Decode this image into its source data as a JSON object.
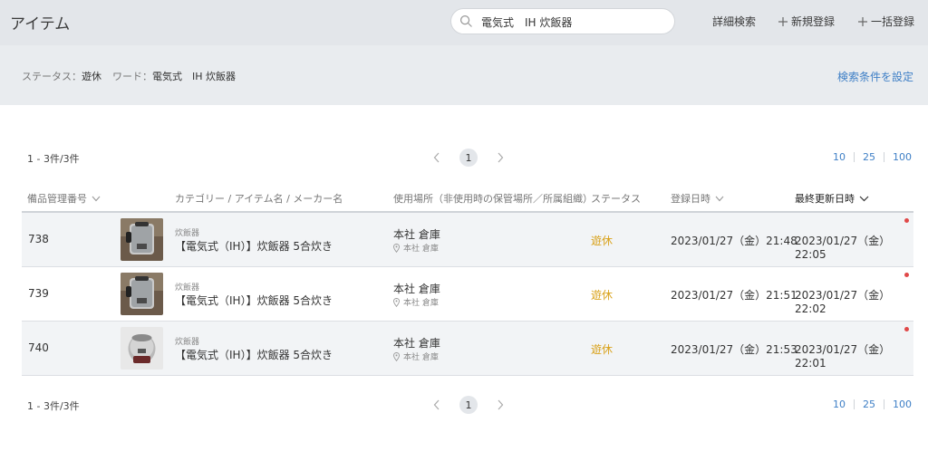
{
  "header": {
    "title": "アイテム",
    "search_value": "電気式　IH 炊飯器",
    "advanced_search": "詳細検索",
    "new_register": "新規登録",
    "bulk_register": "一括登録"
  },
  "filter": {
    "status_label": "ステータス：",
    "status_value": "遊休",
    "word_label": "ワード：",
    "word_value": "電気式　IH 炊飯器",
    "set_conditions": "検索条件を設定"
  },
  "pagination": {
    "count_text": "1 - 3件/3件",
    "current_page": "1",
    "per_page_options": [
      "10",
      "25",
      "100"
    ]
  },
  "table": {
    "columns": {
      "id": "備品管理番号",
      "name": "カテゴリー / アイテム名 / メーカー名",
      "location": "使用場所（非使用時の保管場所／所属組織）",
      "status": "ステータス",
      "registered": "登録日時",
      "updated": "最終更新日時"
    },
    "rows": [
      {
        "id": "738",
        "category": "炊飯器",
        "name": "【電気式（IH）】炊飯器 5合炊き",
        "location": "本社 倉庫",
        "location_sub": "本社 倉庫",
        "status": "遊休",
        "registered": "2023/01/27（金）21:48",
        "updated": "2023/01/27（金）22:05"
      },
      {
        "id": "739",
        "category": "炊飯器",
        "name": "【電気式（IH）】炊飯器 5合炊き",
        "location": "本社 倉庫",
        "location_sub": "本社 倉庫",
        "status": "遊休",
        "registered": "2023/01/27（金）21:51",
        "updated": "2023/01/27（金）22:02"
      },
      {
        "id": "740",
        "category": "炊飯器",
        "name": "【電気式（IH）】炊飯器 5合炊き",
        "location": "本社 倉庫",
        "location_sub": "本社 倉庫",
        "status": "遊休",
        "registered": "2023/01/27（金）21:53",
        "updated": "2023/01/27（金）22:01"
      }
    ]
  },
  "colors": {
    "accent": "#3e7fc6",
    "status_idle": "#d9a21b",
    "unread_dot": "#e04848"
  },
  "icons": {
    "search": "search-icon",
    "plus": "plus-icon",
    "chevron_left": "chevron-left-icon",
    "chevron_right": "chevron-right-icon",
    "chevron_down": "chevron-down-icon",
    "location_pin": "location-pin-icon"
  }
}
